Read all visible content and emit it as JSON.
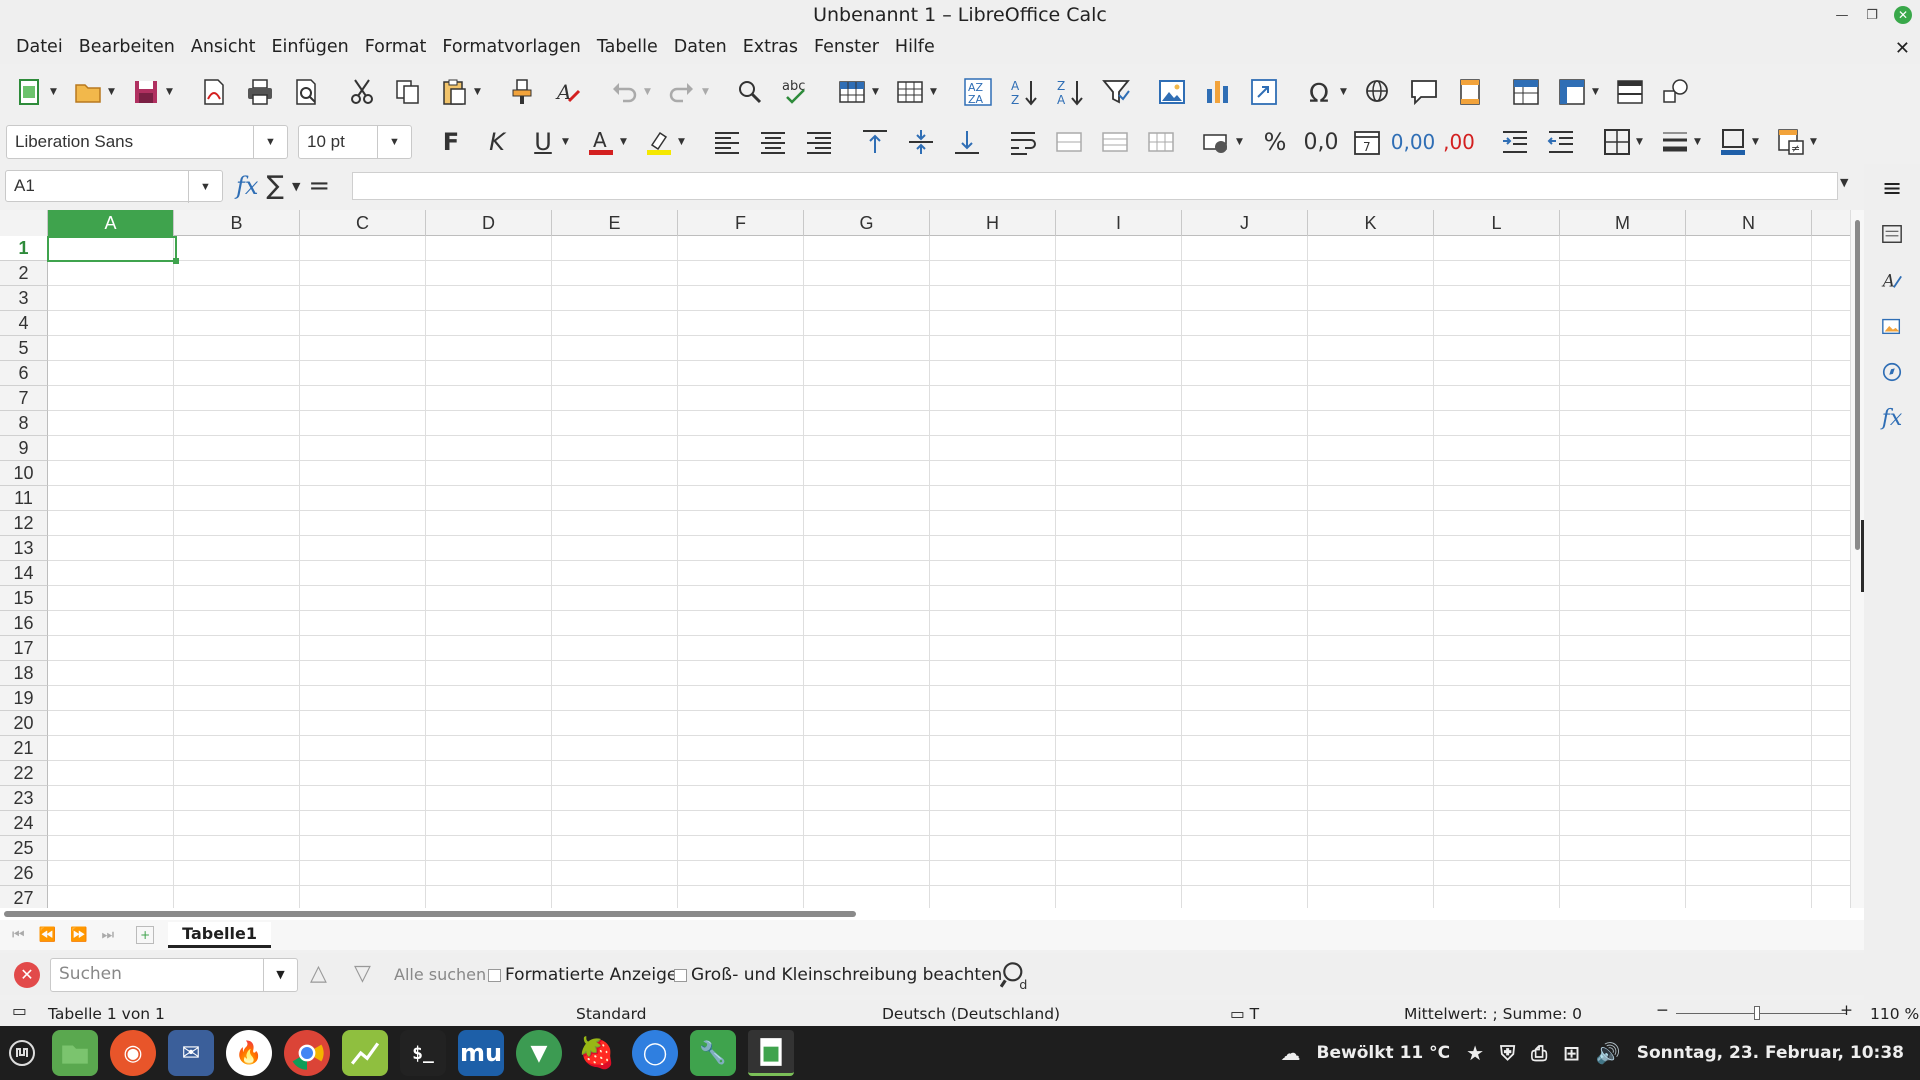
{
  "window": {
    "title": "Unbenannt 1 – LibreOffice Calc",
    "doc_close": "✕"
  },
  "menu": [
    "Datei",
    "Bearbeiten",
    "Ansicht",
    "Einfügen",
    "Format",
    "Formatvorlagen",
    "Tabelle",
    "Daten",
    "Extras",
    "Fenster",
    "Hilfe"
  ],
  "format_bar": {
    "font_name": "Liberation Sans",
    "font_size": "10 pt",
    "bold_label": "F",
    "italic_label": "K",
    "underline_label": "U",
    "percent_label": "%",
    "decimal_label": "0,0",
    "add_decimal_label": "0,00",
    "remove_decimal_label": ",00",
    "font_color": "#d32020",
    "highlight_color": "#f5e800",
    "border_color": "#1f5fa8"
  },
  "formula_bar": {
    "cell_ref": "A1",
    "fx": "fx",
    "sum": "∑",
    "equals": "=",
    "content": ""
  },
  "grid": {
    "columns": [
      "A",
      "B",
      "C",
      "D",
      "E",
      "F",
      "G",
      "H",
      "I",
      "J",
      "K",
      "L",
      "M",
      "N"
    ],
    "rows": [
      "1",
      "2",
      "3",
      "4",
      "5",
      "6",
      "7",
      "8",
      "9",
      "10",
      "11",
      "12",
      "13",
      "14",
      "15",
      "16",
      "17",
      "18",
      "19",
      "20",
      "21",
      "22",
      "23",
      "24",
      "25",
      "26",
      "27"
    ],
    "selected_cell": "A1"
  },
  "sheet_tabs": {
    "tabs": [
      "Tabelle1"
    ],
    "active": "Tabelle1"
  },
  "find_bar": {
    "placeholder": "Suchen",
    "find_all": "Alle suchen",
    "formatted_display": "Formatierte Anzeige",
    "match_case": "Groß- und Kleinschreibung beachten"
  },
  "status": {
    "sheet_info": "Tabelle 1 von 1",
    "page_style": "Standard",
    "language": "Deutsch (Deutschland)",
    "summary": "Mittelwert: ; Summe: 0",
    "zoom": "110 %"
  },
  "taskbar": {
    "apps": [
      "menu-icon",
      "files-icon",
      "firefox-icon",
      "mail-icon",
      "flame-icon",
      "chrome-icon",
      "chart-icon",
      "terminal-icon",
      "mu-editor-icon",
      "shield-leaf-icon",
      "strawberry-icon",
      "chat-icon",
      "tools-icon",
      "calc-icon"
    ],
    "weather": "Bewölkt 11 °C",
    "clock": "Sonntag, 23. Februar, 10:38"
  }
}
